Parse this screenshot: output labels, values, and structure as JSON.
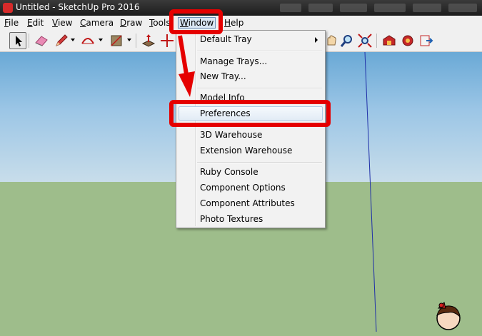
{
  "titlebar": {
    "title": "Untitled - SketchUp Pro 2016"
  },
  "menubar": {
    "items": [
      {
        "label": "File",
        "u": "F",
        "rest": "ile"
      },
      {
        "label": "Edit",
        "u": "E",
        "rest": "dit"
      },
      {
        "label": "View",
        "u": "V",
        "rest": "iew"
      },
      {
        "label": "Camera",
        "u": "C",
        "rest": "amera"
      },
      {
        "label": "Draw",
        "u": "D",
        "rest": "raw"
      },
      {
        "label": "Tools",
        "u": "T",
        "rest": "ools"
      },
      {
        "label": "Window",
        "u": "W",
        "rest": "indow"
      },
      {
        "label": "Help",
        "u": "H",
        "rest": "elp"
      }
    ]
  },
  "toolbar": {
    "icons": [
      "select-icon",
      "eraser-icon",
      "pencil-icon",
      "arc-icon",
      "paint-bucket-icon",
      "push-pull-icon",
      "tape-measure-icon",
      "pan-icon",
      "zoom-icon",
      "zoom-extents-icon",
      "warehouse-icon",
      "extension-warehouse-icon",
      "send-to-layout-icon"
    ]
  },
  "window_menu": {
    "items": [
      {
        "label": "Default Tray",
        "submenu": true
      },
      {
        "label": "Manage Trays..."
      },
      {
        "label": "New Tray..."
      },
      {
        "label": "Model Info"
      },
      {
        "label": "Preferences",
        "highlighted": true
      },
      {
        "label": "3D Warehouse"
      },
      {
        "label": "Extension Warehouse"
      },
      {
        "label": "Ruby Console"
      },
      {
        "label": "Component Options"
      },
      {
        "label": "Component Attributes"
      },
      {
        "label": "Photo Textures"
      }
    ]
  },
  "annotation": {
    "color": "#e50000"
  },
  "colors": {
    "sky_top": "#6aa9d6",
    "ground": "#9ebd8b",
    "axis_blue": "#1f2fa8"
  }
}
